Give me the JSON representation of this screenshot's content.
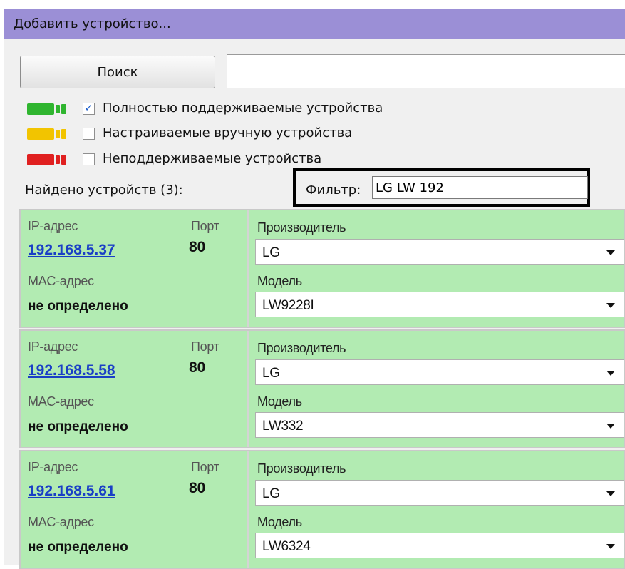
{
  "window": {
    "title": "Добавить устройство..."
  },
  "toolbar": {
    "search_label": "Поиск",
    "search_value": ""
  },
  "legend": [
    {
      "color": "#2fb52f",
      "checked": true,
      "label": "Полностью поддерживаемые устройства"
    },
    {
      "color": "#f2c400",
      "checked": false,
      "label": "Настраиваемые вручную устройства"
    },
    {
      "color": "#e02020",
      "checked": false,
      "label": "Неподдерживаемые устройства"
    }
  ],
  "found_label": "Найдено устройств (3):",
  "filter": {
    "label": "Фильтр:",
    "value": "LG LW 192"
  },
  "labels": {
    "ip": "IP-адрес",
    "port": "Порт",
    "mac": "MAC-адрес",
    "vendor": "Производитель",
    "model": "Модель"
  },
  "devices": [
    {
      "ip": "192.168.5.37",
      "port": "80",
      "mac": "не определено",
      "vendor": "LG",
      "model": "LW9228I"
    },
    {
      "ip": "192.168.5.58",
      "port": "80",
      "mac": "не определено",
      "vendor": "LG",
      "model": "LW332"
    },
    {
      "ip": "192.168.5.61",
      "port": "80",
      "mac": "не определено",
      "vendor": "LG",
      "model": "LW6324"
    }
  ],
  "colors": {
    "titlebar": "#9b8fd6",
    "card": "#b2ebb2",
    "link": "#1a3fc6"
  }
}
